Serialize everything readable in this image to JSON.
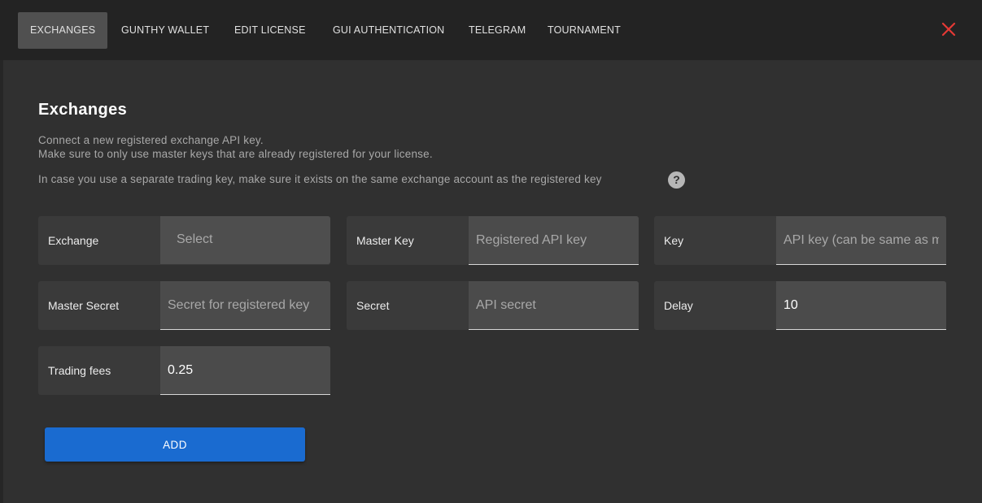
{
  "tabs": [
    {
      "label": "EXCHANGES"
    },
    {
      "label": "GUNTHY WALLET"
    },
    {
      "label": "EDIT LICENSE"
    },
    {
      "label": "GUI AUTHENTICATION"
    },
    {
      "label": "TELEGRAM"
    },
    {
      "label": "TOURNAMENT"
    }
  ],
  "header": {
    "close_icon": "close-icon",
    "accent_color": "#e53935"
  },
  "main": {
    "title": "Exchanges",
    "description_line1": "Connect a new registered exchange API key.",
    "description_line2": "Make sure to only use master keys that are already registered for your license.",
    "description_line3": "In case you use a separate trading key, make sure it exists on the same exchange account as the registered key",
    "help_icon": "question-mark-icon"
  },
  "fields": {
    "exchange": {
      "label": "Exchange",
      "value": "Select"
    },
    "master_key": {
      "label": "Master Key",
      "value": "",
      "placeholder": "Registered API key"
    },
    "key": {
      "label": "Key",
      "value": "",
      "placeholder": "API key (can be same as m"
    },
    "master_secret": {
      "label": "Master Secret",
      "value": "",
      "placeholder": "Secret for registered key"
    },
    "secret": {
      "label": "Secret",
      "value": "",
      "placeholder": "API secret"
    },
    "delay": {
      "label": "Delay",
      "value": "10",
      "placeholder": ""
    },
    "trading_fees": {
      "label": "Trading fees",
      "value": "0.25",
      "placeholder": ""
    }
  },
  "actions": {
    "add_label": "ADD",
    "button_color": "#1a6bd0"
  }
}
